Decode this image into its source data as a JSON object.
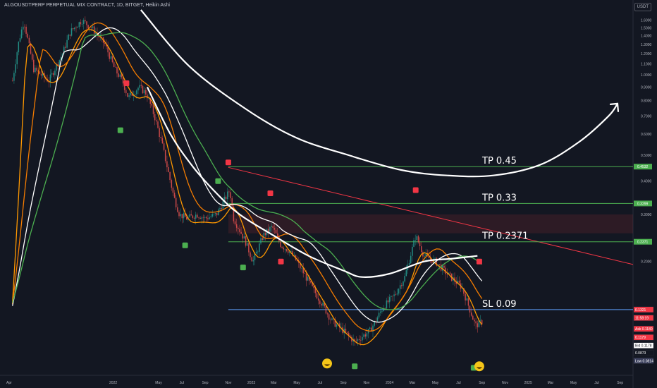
{
  "header": {
    "symbol_line": "ALGOUSDTPERP PERPETUAL MIX CONTRACT, 1D, BITGET, Heikin Ashi",
    "currency": "USDT"
  },
  "chart_data": {
    "type": "candlestick",
    "yscale": "log",
    "ylim": [
      0.075,
      1.75
    ],
    "xlim": [
      "2021-03-08",
      "2025-10-05"
    ],
    "price_ticks": [
      1.6,
      1.5,
      1.4,
      1.3,
      1.2,
      1.1,
      1.0,
      0.9,
      0.8,
      0.7,
      0.6,
      0.5,
      0.4,
      0.3,
      0.2
    ],
    "price_tick_labels": [
      "1.6000",
      "1.5000",
      "1.4000",
      "1.3000",
      "1.2000",
      "1.1000",
      "1.0000",
      "0.9000",
      "0.8000",
      "0.7000",
      "0.6000",
      "0.5000",
      "0.4000",
      "0.3000",
      "0.2000"
    ],
    "time_ticks": [
      {
        "label": "Apr",
        "date": "2021-04-01"
      },
      {
        "label": "2022",
        "date": "2022-01-01"
      },
      {
        "label": "May",
        "date": "2022-05-01"
      },
      {
        "label": "Jul",
        "date": "2022-07-01"
      },
      {
        "label": "Sep",
        "date": "2022-09-01"
      },
      {
        "label": "Nov",
        "date": "2022-11-01"
      },
      {
        "label": "2023",
        "date": "2023-01-01"
      },
      {
        "label": "Mar",
        "date": "2023-03-01"
      },
      {
        "label": "May",
        "date": "2023-05-01"
      },
      {
        "label": "Jul",
        "date": "2023-07-01"
      },
      {
        "label": "Sep",
        "date": "2023-09-01"
      },
      {
        "label": "Nov",
        "date": "2023-11-01"
      },
      {
        "label": "2024",
        "date": "2024-01-01"
      },
      {
        "label": "Mar",
        "date": "2024-03-01"
      },
      {
        "label": "May",
        "date": "2024-05-01"
      },
      {
        "label": "Jul",
        "date": "2024-07-01"
      },
      {
        "label": "Sep",
        "date": "2024-09-01"
      },
      {
        "label": "Nov",
        "date": "2024-11-01"
      },
      {
        "label": "2025",
        "date": "2025-01-01"
      },
      {
        "label": "Mar",
        "date": "2025-03-01"
      },
      {
        "label": "May",
        "date": "2025-05-01"
      },
      {
        "label": "Jul",
        "date": "2025-07-01"
      },
      {
        "label": "Sep",
        "date": "2025-09-01"
      }
    ],
    "price_path": [
      [
        "2021-04-10",
        0.95
      ],
      [
        "2021-04-25",
        1.3
      ],
      [
        "2021-05-10",
        1.6
      ],
      [
        "2021-06-05",
        1.05
      ],
      [
        "2021-07-15",
        0.95
      ],
      [
        "2021-08-20",
        1.2
      ],
      [
        "2021-09-10",
        1.45
      ],
      [
        "2021-10-10",
        1.6
      ],
      [
        "2021-11-05",
        1.5
      ],
      [
        "2021-12-10",
        1.3
      ],
      [
        "2022-01-05",
        1.05
      ],
      [
        "2022-01-25",
        0.95
      ],
      [
        "2022-02-10",
        0.82
      ],
      [
        "2022-03-10",
        0.9
      ],
      [
        "2022-03-30",
        0.85
      ],
      [
        "2022-04-20",
        0.7
      ],
      [
        "2022-05-10",
        0.55
      ],
      [
        "2022-06-10",
        0.35
      ],
      [
        "2022-06-25",
        0.3
      ],
      [
        "2022-07-15",
        0.29
      ],
      [
        "2022-08-10",
        0.3
      ],
      [
        "2022-09-01",
        0.29
      ],
      [
        "2022-10-01",
        0.3
      ],
      [
        "2022-11-05",
        0.37
      ],
      [
        "2022-11-15",
        0.29
      ],
      [
        "2022-12-15",
        0.24
      ],
      [
        "2023-01-05",
        0.2
      ],
      [
        "2023-02-01",
        0.25
      ],
      [
        "2023-02-25",
        0.27
      ],
      [
        "2023-03-20",
        0.23
      ],
      [
        "2023-04-10",
        0.22
      ],
      [
        "2023-05-01",
        0.2
      ],
      [
        "2023-06-10",
        0.16
      ],
      [
        "2023-07-05",
        0.14
      ],
      [
        "2023-08-01",
        0.12
      ],
      [
        "2023-09-01",
        0.11
      ],
      [
        "2023-10-01",
        0.1
      ],
      [
        "2023-11-10",
        0.11
      ],
      [
        "2023-12-15",
        0.135
      ],
      [
        "2024-01-15",
        0.15
      ],
      [
        "2024-02-10",
        0.175
      ],
      [
        "2024-03-10",
        0.25
      ],
      [
        "2024-04-01",
        0.21
      ],
      [
        "2024-05-01",
        0.2
      ],
      [
        "2024-06-01",
        0.18
      ],
      [
        "2024-07-10",
        0.16
      ],
      [
        "2024-08-15",
        0.115
      ],
      [
        "2024-09-05",
        0.12
      ]
    ],
    "moving_averages": [
      {
        "color": "#ff9800",
        "offset": 0.95,
        "lag": 10
      },
      {
        "color": "#f57c00",
        "offset": 1.04,
        "lag": 20
      },
      {
        "color": "#ffffff",
        "offset": 1.07,
        "lag": 34
      },
      {
        "color": "#4caf50",
        "offset": 1.12,
        "lag": 48
      }
    ],
    "levels": [
      {
        "label": "TP 0.45",
        "price": 0.4532,
        "color": "#4caf50",
        "tag": "0.4532"
      },
      {
        "label": "TP 0.33",
        "price": 0.3299,
        "color": "#4caf50",
        "tag": "0.3299"
      },
      {
        "label": "TP 0.2371",
        "price": 0.2371,
        "color": "#4caf50",
        "tag": "0.2371"
      },
      {
        "label": "SL 0.09",
        "price": 0.1321,
        "color": "#5b9cf6",
        "tag": ""
      }
    ],
    "resistance_band": {
      "low": 0.255,
      "high": 0.3,
      "color": "#f23645"
    },
    "trendline": {
      "from": [
        "2022-11-01",
        0.45
      ],
      "to": [
        "2025-10-05",
        0.195
      ],
      "color": "#f23645"
    },
    "price_tags": [
      {
        "text": "0.1321",
        "price": 0.1321,
        "bg": "#f23645"
      },
      {
        "text": "11:58:19",
        "price": 0.123,
        "bg": "#f23645"
      },
      {
        "text": "Ask  0.1180",
        "price": 0.112,
        "bg": "#f23645"
      },
      {
        "text": "0.1179",
        "price": 0.104,
        "bg": "#f23645"
      },
      {
        "text": "Bid  0.1178",
        "price": 0.097,
        "bg": "#ffffff"
      },
      {
        "text": "0.0873",
        "price": 0.091,
        "bg": "#131722"
      },
      {
        "text": "Low  0.0814",
        "price": 0.085,
        "bg": "#3a3f5c"
      }
    ],
    "arc_curve": [
      [
        "2022-03-15",
        1.75
      ],
      [
        "2022-07-20",
        1.08
      ],
      [
        "2022-12-20",
        0.74
      ],
      [
        "2023-05-01",
        0.58
      ],
      [
        "2023-09-15",
        0.5
      ],
      [
        "2024-02-01",
        0.44
      ],
      [
        "2024-06-01",
        0.42
      ],
      [
        "2024-10-01",
        0.42
      ],
      [
        "2025-02-01",
        0.46
      ],
      [
        "2025-05-15",
        0.56
      ],
      [
        "2025-08-01",
        0.7
      ],
      [
        "2025-08-25",
        0.78
      ]
    ],
    "hand_curve": [
      [
        "2022-04-01",
        0.9
      ],
      [
        "2022-06-01",
        0.6
      ],
      [
        "2022-08-01",
        0.45
      ],
      [
        "2022-10-01",
        0.36
      ],
      [
        "2022-12-01",
        0.3
      ],
      [
        "2023-03-01",
        0.25
      ],
      [
        "2023-06-01",
        0.21
      ],
      [
        "2023-09-01",
        0.185
      ],
      [
        "2023-10-20",
        0.175
      ],
      [
        "2024-01-01",
        0.18
      ],
      [
        "2024-04-01",
        0.2
      ],
      [
        "2024-06-15",
        0.205
      ],
      [
        "2024-08-20",
        0.21
      ]
    ],
    "markers": [
      {
        "date": "2022-01-20",
        "price": 0.62,
        "color": "#4caf50"
      },
      {
        "date": "2022-02-05",
        "price": 0.93,
        "color": "#f23645"
      },
      {
        "date": "2022-07-10",
        "price": 0.23,
        "color": "#4caf50"
      },
      {
        "date": "2022-10-05",
        "price": 0.4,
        "color": "#4caf50"
      },
      {
        "date": "2022-11-01",
        "price": 0.47,
        "color": "#f23645"
      },
      {
        "date": "2022-12-10",
        "price": 0.19,
        "color": "#4caf50"
      },
      {
        "date": "2023-02-20",
        "price": 0.36,
        "color": "#f23645"
      },
      {
        "date": "2023-03-20",
        "price": 0.2,
        "color": "#f23645"
      },
      {
        "date": "2023-10-01",
        "price": 0.081,
        "color": "#4caf50"
      },
      {
        "date": "2024-03-10",
        "price": 0.37,
        "color": "#f23645"
      },
      {
        "date": "2024-08-25",
        "price": 0.2,
        "color": "#f23645"
      },
      {
        "date": "2024-08-10",
        "price": 0.08,
        "color": "#4caf50"
      }
    ],
    "emoji_markers": [
      {
        "date": "2023-07-20",
        "price": 0.083
      },
      {
        "date": "2024-08-25",
        "price": 0.081
      }
    ]
  }
}
